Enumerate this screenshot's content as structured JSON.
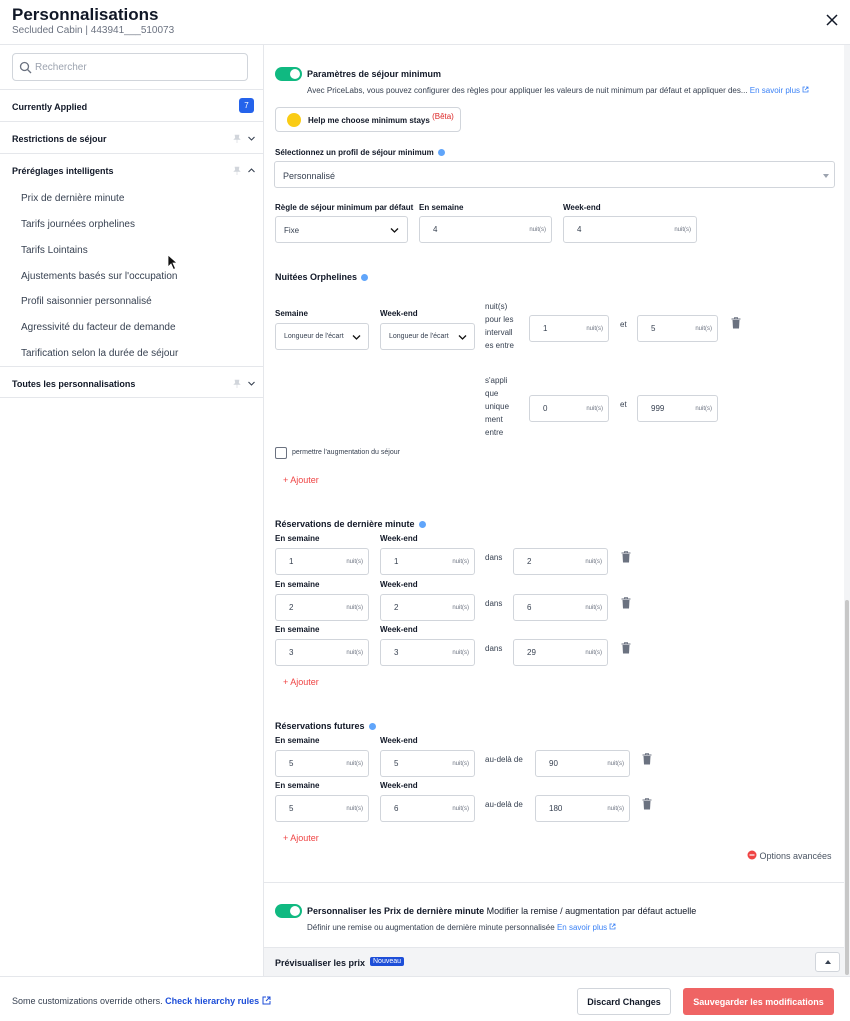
{
  "header": {
    "title": "Personnalisations",
    "subtitle": "Secluded Cabin | 443941___510073"
  },
  "sidebar": {
    "search_placeholder": "Rechercher",
    "currently_applied": "Currently Applied",
    "currently_applied_count": "7",
    "sections": {
      "restrictions": "Restrictions de séjour",
      "smart_presets": "Préréglages intelligents",
      "all": "Toutes les personnalisations"
    },
    "preset_items": [
      "Prix de dernière minute",
      "Tarifs journées orphelines",
      "Tarifs Lointains",
      "Ajustements basés sur l'occupation",
      "Profil saisonnier personnalisé",
      "Agressivité du facteur de demande",
      "Tarification selon la durée de séjour"
    ]
  },
  "main": {
    "min_stay": {
      "title": "Paramètres de séjour minimum",
      "description": "Avec PriceLabs, vous pouvez configurer des règles pour appliquer les valeurs de nuit minimum par défaut et appliquer des...",
      "learn_more": "En savoir plus",
      "help_button": "Help me choose minimum stays",
      "beta": "(Bêta)",
      "profile_label": "Sélectionnez un profil de séjour minimum",
      "profile_value": "Personnalisé",
      "rule_label": "Règle de séjour minimum par défaut",
      "rule_value": "Fixe",
      "weekday_label": "En semaine",
      "weekday_value": "4",
      "weekend_label": "Week-end",
      "weekend_value": "4",
      "unit": "nuit(s)"
    },
    "orphan": {
      "title": "Nuitées Orphelines",
      "week_label": "Semaine",
      "weekend_label": "Week-end",
      "gap_option": "Longueur de l'écart",
      "range_text": [
        "nuit(s)",
        "pour les",
        "intervall",
        "es entre"
      ],
      "range_from": "1",
      "range_to": "5",
      "and": "et",
      "apply_text": [
        "s'appli",
        "que",
        "unique",
        "ment",
        "entre"
      ],
      "apply_from": "0",
      "apply_to": "999",
      "allow_increase": "permettre l'augmentation du séjour",
      "add": "+ Ajouter"
    },
    "last_minute": {
      "title": "Réservations de dernière minute",
      "weekday_label": "En semaine",
      "weekend_label": "Week-end",
      "within": "dans",
      "rows": [
        {
          "weekday": "1",
          "weekend": "1",
          "within": "2"
        },
        {
          "weekday": "2",
          "weekend": "2",
          "within": "6"
        },
        {
          "weekday": "3",
          "weekend": "3",
          "within": "29"
        }
      ],
      "add": "+ Ajouter"
    },
    "future": {
      "title": "Réservations futures",
      "weekday_label": "En semaine",
      "weekend_label": "Week-end",
      "beyond": "au-delà de",
      "rows": [
        {
          "weekday": "5",
          "weekend": "5",
          "beyond": "90"
        },
        {
          "weekday": "5",
          "weekend": "6",
          "beyond": "180"
        }
      ],
      "add": "+ Ajouter",
      "advanced": "Options avancées"
    },
    "last_minute_prices": {
      "title": "Personnaliser les Prix de dernière minute",
      "title_suffix": "Modifier la remise / augmentation par défaut actuelle",
      "description": "Définir une remise ou augmentation de dernière minute personnalisée",
      "learn_more": "En savoir plus"
    }
  },
  "preview": {
    "label": "Prévisualiser les prix",
    "badge": "Nouveau"
  },
  "footer": {
    "note": "Some customizations override others.",
    "link": "Check hierarchy rules",
    "discard": "Discard Changes",
    "save": "Sauvegarder les modifications"
  },
  "colors": {
    "accent_blue": "#2563eb",
    "toggle_green": "#10b981",
    "danger_red": "#ef6464"
  }
}
